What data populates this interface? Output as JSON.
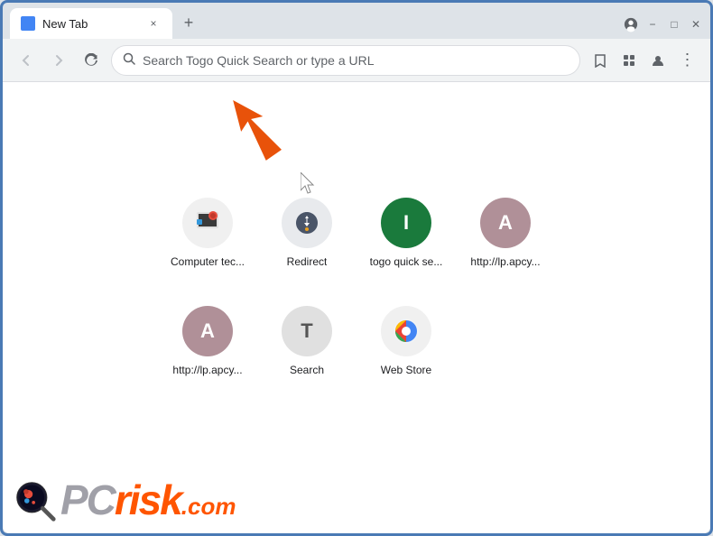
{
  "window": {
    "title": "New Tab",
    "controls": {
      "minimize": "−",
      "maximize": "□",
      "close": "✕"
    }
  },
  "tab": {
    "label": "New Tab",
    "close_btn": "×"
  },
  "new_tab_btn": "+",
  "toolbar": {
    "back_btn": "‹",
    "forward_btn": "›",
    "reload_btn": "↻",
    "address_placeholder": "Search Togo Quick Search or type a URL",
    "bookmark_icon": "☆",
    "extension_icon": "🧩",
    "profile_icon": "👤",
    "menu_icon": "⋮",
    "chrome_menu_icon": "⊙"
  },
  "shortcuts": [
    {
      "id": "computer-tec",
      "label": "Computer tec...",
      "icon_text": "🖼",
      "icon_class": "icon-computer-tec"
    },
    {
      "id": "redirect",
      "label": "Redirect",
      "icon_text": "⚓",
      "icon_class": "icon-redirect"
    },
    {
      "id": "togo-quick-se",
      "label": "togo quick se...",
      "icon_text": "I",
      "icon_class": "icon-togo"
    },
    {
      "id": "http-lp-apcy-1",
      "label": "http://lp.apcy...",
      "icon_text": "A",
      "icon_class": "icon-apcy1"
    },
    {
      "id": "http-lp-apcy-2",
      "label": "http://lp.apcy...",
      "icon_text": "A",
      "icon_class": "icon-apcy2"
    },
    {
      "id": "search",
      "label": "Search",
      "icon_text": "T",
      "icon_class": "icon-search"
    },
    {
      "id": "web-store",
      "label": "Web Store",
      "icon_text": "",
      "icon_class": "icon-webstore"
    }
  ],
  "logo": {
    "pc": "PC",
    "risk": "risk",
    "com": ".com"
  }
}
